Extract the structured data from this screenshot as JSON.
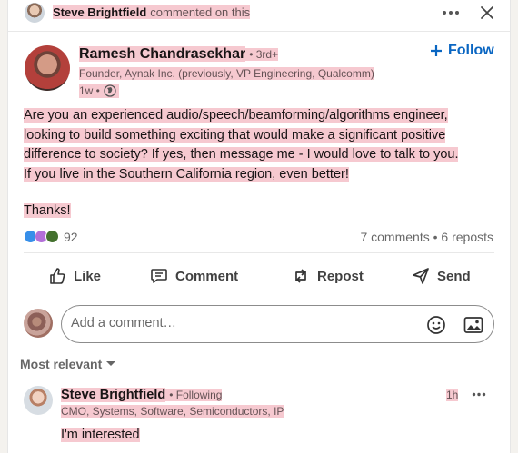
{
  "notification": {
    "actor": "Steve Brightfield",
    "action": "commented on this"
  },
  "post": {
    "author": {
      "name": "Ramesh Chandrasekhar",
      "degree": "• 3rd+",
      "headline": "Founder, Aynak Inc. (previously, VP Engineering, Qualcomm)",
      "age": "1w •"
    },
    "follow_label": "Follow",
    "body": [
      "Are you an experienced audio/speech/beamforming/algorithms engineer,",
      "looking to build something exciting that would make a significant positive",
      "difference to society? If yes, then message me - I would love to talk to you.",
      "If you live in the Southern California region, even better!"
    ],
    "signoff": "Thanks!",
    "reaction_count": "92",
    "comments_count": "7 comments",
    "reposts_count": "6 reposts",
    "separator": "•"
  },
  "actions": {
    "like": "Like",
    "comment": "Comment",
    "repost": "Repost",
    "send": "Send"
  },
  "composer": {
    "placeholder": "Add a comment…"
  },
  "sort": {
    "label": "Most relevant"
  },
  "comment": {
    "author": "Steve Brightfield",
    "following": "• Following",
    "headline": "CMO, Systems, Software, Semiconductors, IP",
    "age": "1h",
    "text": "I'm interested"
  },
  "colors": {
    "accent": "#0a66c2",
    "highlight": "#f6c9d0"
  },
  "icons": [
    "ellipsis-icon",
    "close-icon",
    "globe-icon",
    "plus-icon",
    "like-icon",
    "comment-icon",
    "repost-icon",
    "send-icon",
    "emoji-icon",
    "image-icon",
    "chevron-down-icon"
  ]
}
